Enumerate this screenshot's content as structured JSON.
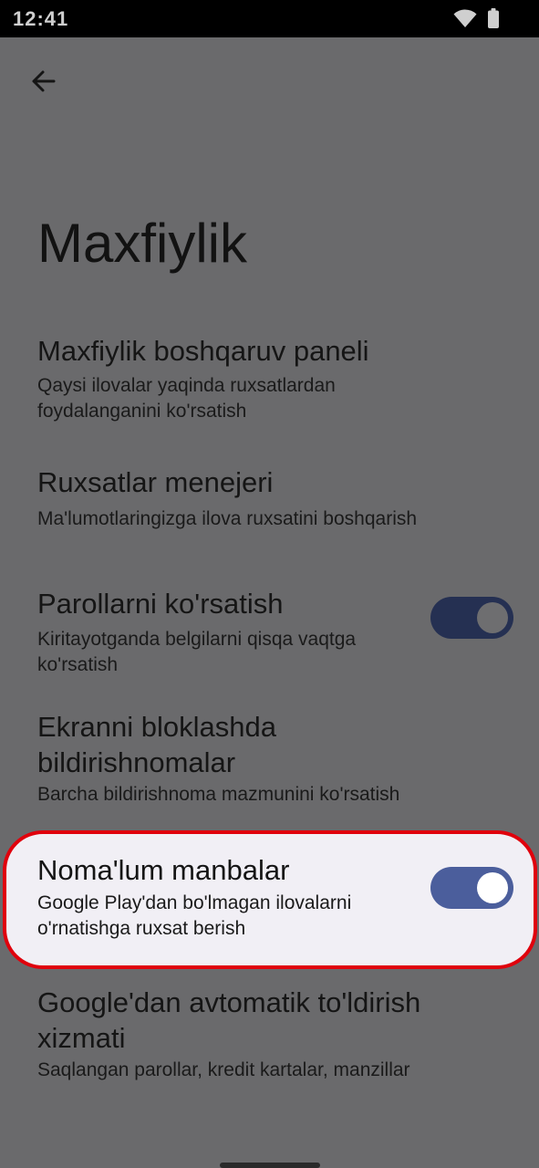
{
  "status_bar": {
    "time": "12:41",
    "icons": [
      "wifi-icon",
      "battery-icon"
    ]
  },
  "header": {
    "back_icon": "arrow-back-icon",
    "title": "Maxfiylik"
  },
  "items": [
    {
      "title": "Maxfiylik boshqaruv paneli",
      "summary": "Qaysi ilovalar yaqinda ruxsatlardan foydalanganini ko'rsatish"
    },
    {
      "title": "Ruxsatlar menejeri",
      "summary": "Ma'lumotlaringizga ilova ruxsatini boshqarish"
    },
    {
      "title": "Parollarni ko'rsatish",
      "summary": "Kiritayotganda belgilarni qisqa vaqtga ko'rsatish",
      "toggle": "on"
    },
    {
      "title": "Ekranni bloklashda bildirishnomalar",
      "summary": "Barcha bildirishnoma mazmunini ko'rsatish"
    },
    {
      "title": "Noma'lum manbalar",
      "summary": "Google Play'dan bo'lmagan ilovalarni o'rnatishga ruxsat berish",
      "toggle": "on",
      "highlighted": true
    },
    {
      "title": "Google'dan avtomatik to'ldirish xizmati",
      "summary": "Saqlangan parollar, kredit kartalar, manzillar"
    }
  ],
  "colors": {
    "scrim_background": "#6a6a6c",
    "highlight_border": "#e0000c",
    "toggle_on_dim": "#253052",
    "toggle_on": "#4b5e9c"
  }
}
